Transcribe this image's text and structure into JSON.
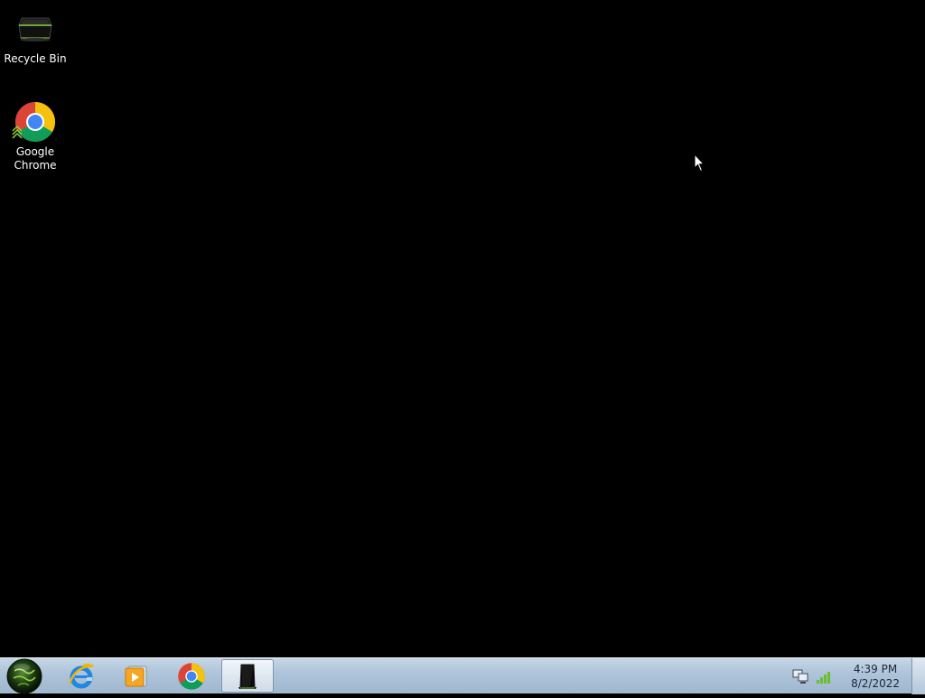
{
  "desktop": {
    "icons": [
      {
        "label": "Recycle Bin",
        "icon": "recycle-bin-icon"
      },
      {
        "label": "Google\nChrome",
        "icon": "chrome-icon"
      }
    ]
  },
  "taskbar": {
    "start": {
      "icon": "start-orb-icon"
    },
    "pinned": [
      {
        "icon": "internet-explorer-icon",
        "active": false
      },
      {
        "icon": "media-player-icon",
        "active": false
      },
      {
        "icon": "chrome-icon",
        "active": false
      },
      {
        "icon": "recycle-bin-icon",
        "active": true
      }
    ],
    "tray": {
      "icons": [
        "network-icon",
        "signal-bars-icon"
      ],
      "time": "4:39 PM",
      "date": "8/2/2022"
    }
  },
  "colors": {
    "desktop_background": "#000000",
    "taskbar_top": "#c6d6e6",
    "taskbar_bottom": "#9fb7cf",
    "accent_green": "#7ac943"
  }
}
